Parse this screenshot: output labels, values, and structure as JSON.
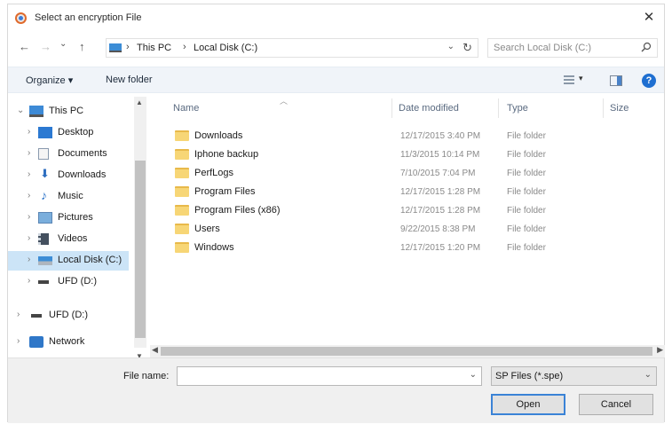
{
  "window": {
    "title": "Select an encryption File",
    "close": "✕"
  },
  "nav": {
    "back": "←",
    "forward": "→",
    "recent": "⌄",
    "up": "↑",
    "breadcrumbs": [
      "This PC",
      "Local Disk (C:)"
    ],
    "separator": "›",
    "address_dropdown": "⌄",
    "refresh": "↻",
    "search_placeholder": "Search Local Disk (C:)"
  },
  "toolbar": {
    "organize": "Organize ▾",
    "new_folder": "New folder",
    "help": "?"
  },
  "tree": {
    "items": [
      {
        "label": "This PC",
        "arrow": "⌄",
        "icon": "pc-icon"
      },
      {
        "label": "Desktop",
        "arrow": "›",
        "icon": "desktop-icon"
      },
      {
        "label": "Documents",
        "arrow": "›",
        "icon": "documents-icon"
      },
      {
        "label": "Downloads",
        "arrow": "›",
        "icon": "downloads-icon"
      },
      {
        "label": "Music",
        "arrow": "›",
        "icon": "music-icon"
      },
      {
        "label": "Pictures",
        "arrow": "›",
        "icon": "pictures-icon"
      },
      {
        "label": "Videos",
        "arrow": "›",
        "icon": "videos-icon"
      },
      {
        "label": "Local Disk (C:)",
        "arrow": "›",
        "icon": "local-disk-icon",
        "selected": true
      },
      {
        "label": "UFD (D:)",
        "arrow": "›",
        "icon": "usb-drive-icon"
      },
      {
        "label": "UFD (D:)",
        "arrow": "›",
        "icon": "usb-drive-icon"
      },
      {
        "label": "Network",
        "arrow": "›",
        "icon": "network-icon"
      }
    ]
  },
  "columns": {
    "name": "Name",
    "date": "Date modified",
    "type": "Type",
    "size": "Size"
  },
  "files": [
    {
      "name": "Downloads",
      "date": "12/17/2015 3:40 PM",
      "type": "File folder"
    },
    {
      "name": "Iphone backup",
      "date": "11/3/2015 10:14 PM",
      "type": "File folder"
    },
    {
      "name": "PerfLogs",
      "date": "7/10/2015 7:04 PM",
      "type": "File folder"
    },
    {
      "name": "Program Files",
      "date": "12/17/2015 1:28 PM",
      "type": "File folder"
    },
    {
      "name": "Program Files (x86)",
      "date": "12/17/2015 1:28 PM",
      "type": "File folder"
    },
    {
      "name": "Users",
      "date": "9/22/2015 8:38 PM",
      "type": "File folder"
    },
    {
      "name": "Windows",
      "date": "12/17/2015 1:20 PM",
      "type": "File folder"
    }
  ],
  "bottom": {
    "file_name_label": "File name:",
    "file_name_value": "",
    "file_type": "SP Files (*.spe)",
    "open": "Open",
    "cancel": "Cancel"
  },
  "colors": {
    "accent": "#3b83d6",
    "selected_bg": "#cce4f7",
    "toolbar_bg": "#f0f4f9"
  }
}
